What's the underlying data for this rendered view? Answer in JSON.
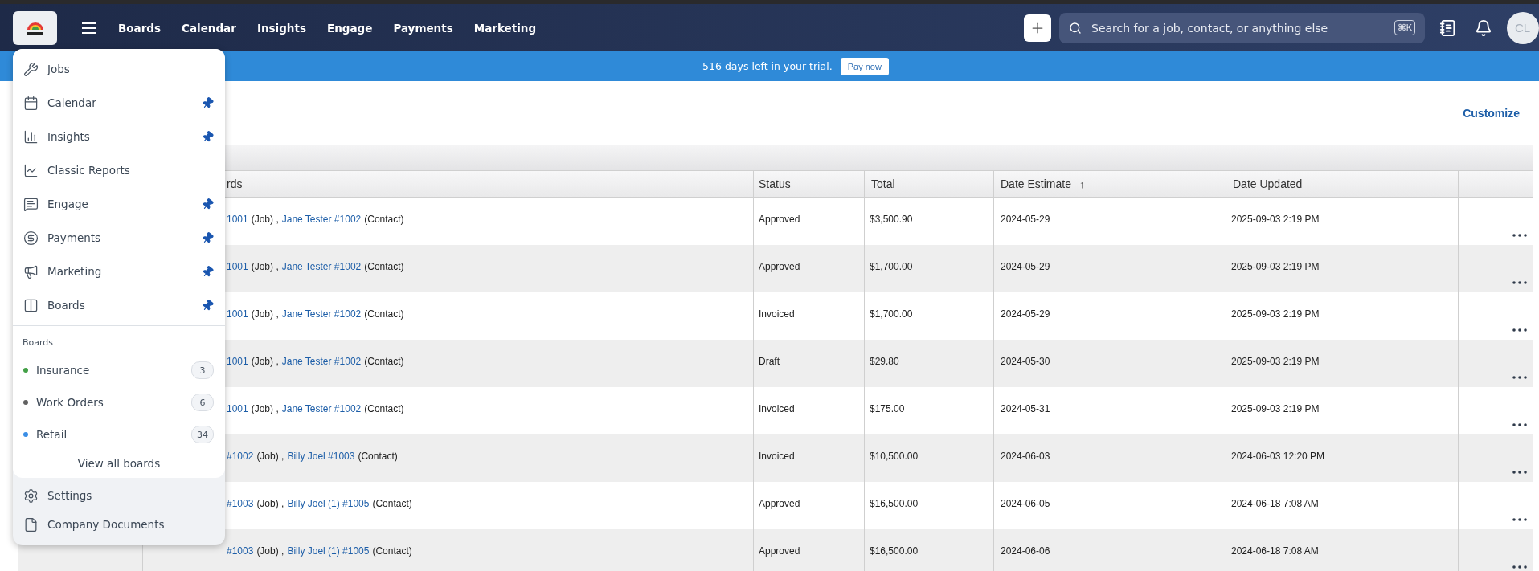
{
  "nav": {
    "links": [
      "Boards",
      "Calendar",
      "Insights",
      "Engage",
      "Payments",
      "Marketing"
    ],
    "search": {
      "placeholder": "Search for a job, contact, or anything else",
      "shortcut": "⌘K"
    },
    "avatar": "CL"
  },
  "banner": {
    "text": "516 days left in your trial.",
    "button": "Pay now"
  },
  "customize": "Customize",
  "table": {
    "columns": [
      {
        "label": "rds"
      },
      {
        "label": "Status"
      },
      {
        "label": "Total"
      },
      {
        "label": "Date Estimate",
        "sort_mark": "↑"
      },
      {
        "label": "Date Updated"
      }
    ],
    "rows": [
      {
        "records": [
          {
            "kind": "link",
            "text": "1001"
          },
          {
            "kind": "plain",
            "text": "(Job) ,"
          },
          {
            "kind": "link",
            "text": "Jane Tester #1002"
          },
          {
            "kind": "plain",
            "text": "(Contact)"
          }
        ],
        "status": "Approved",
        "total": "$3,500.90",
        "date_estimate": "2024-05-29",
        "date_updated": "2025-09-03 2:19 PM"
      },
      {
        "records": [
          {
            "kind": "link",
            "text": "1001"
          },
          {
            "kind": "plain",
            "text": "(Job) ,"
          },
          {
            "kind": "link",
            "text": "Jane Tester #1002"
          },
          {
            "kind": "plain",
            "text": "(Contact)"
          }
        ],
        "status": "Approved",
        "total": "$1,700.00",
        "date_estimate": "2024-05-29",
        "date_updated": "2025-09-03 2:19 PM"
      },
      {
        "records": [
          {
            "kind": "link",
            "text": "1001"
          },
          {
            "kind": "plain",
            "text": "(Job) ,"
          },
          {
            "kind": "link",
            "text": "Jane Tester #1002"
          },
          {
            "kind": "plain",
            "text": "(Contact)"
          }
        ],
        "status": "Invoiced",
        "total": "$1,700.00",
        "date_estimate": "2024-05-29",
        "date_updated": "2025-09-03 2:19 PM"
      },
      {
        "records": [
          {
            "kind": "link",
            "text": "1001"
          },
          {
            "kind": "plain",
            "text": "(Job) ,"
          },
          {
            "kind": "link",
            "text": "Jane Tester #1002"
          },
          {
            "kind": "plain",
            "text": "(Contact)"
          }
        ],
        "status": "Draft",
        "total": "$29.80",
        "date_estimate": "2024-05-30",
        "date_updated": "2025-09-03 2:19 PM"
      },
      {
        "records": [
          {
            "kind": "link",
            "text": "1001"
          },
          {
            "kind": "plain",
            "text": "(Job) ,"
          },
          {
            "kind": "link",
            "text": "Jane Tester #1002"
          },
          {
            "kind": "plain",
            "text": "(Contact)"
          }
        ],
        "status": "Invoiced",
        "total": "$175.00",
        "date_estimate": "2024-05-31",
        "date_updated": "2025-09-03 2:19 PM"
      },
      {
        "records": [
          {
            "kind": "link",
            "text": "#1002"
          },
          {
            "kind": "plain",
            "text": "(Job) ,"
          },
          {
            "kind": "link",
            "text": "Billy Joel #1003"
          },
          {
            "kind": "plain",
            "text": "(Contact)"
          }
        ],
        "status": "Invoiced",
        "total": "$10,500.00",
        "date_estimate": "2024-06-03",
        "date_updated": "2024-06-03 12:20 PM"
      },
      {
        "records": [
          {
            "kind": "link",
            "text": "#1003"
          },
          {
            "kind": "plain",
            "text": "(Job) ,"
          },
          {
            "kind": "link",
            "text": "Billy Joel (1) #1005"
          },
          {
            "kind": "plain",
            "text": "(Contact)"
          }
        ],
        "status": "Approved",
        "total": "$16,500.00",
        "date_estimate": "2024-06-05",
        "date_updated": "2024-06-18 7:08 AM"
      },
      {
        "records": [
          {
            "kind": "link",
            "text": "#1003"
          },
          {
            "kind": "plain",
            "text": "(Job) ,"
          },
          {
            "kind": "link",
            "text": "Billy Joel (1) #1005"
          },
          {
            "kind": "plain",
            "text": "(Contact)"
          }
        ],
        "status": "Approved",
        "total": "$16,500.00",
        "date_estimate": "2024-06-06",
        "date_updated": "2024-06-18 7:08 AM"
      }
    ]
  },
  "menu": {
    "items": [
      {
        "label": "Jobs",
        "pinned": false
      },
      {
        "label": "Calendar",
        "pinned": true
      },
      {
        "label": "Insights",
        "pinned": true
      },
      {
        "label": "Classic Reports",
        "pinned": false
      },
      {
        "label": "Engage",
        "pinned": true
      },
      {
        "label": "Payments",
        "pinned": true
      },
      {
        "label": "Marketing",
        "pinned": true
      },
      {
        "label": "Boards",
        "pinned": true
      }
    ],
    "boards_heading": "Boards",
    "boards": [
      {
        "name": "Insurance",
        "count": "3",
        "color": "#43a047"
      },
      {
        "name": "Work Orders",
        "count": "6",
        "color": "#616161"
      },
      {
        "name": "Retail",
        "count": "34",
        "color": "#3a8ee6"
      }
    ],
    "view_all": "View all boards",
    "footer": [
      {
        "label": "Settings"
      },
      {
        "label": "Company Documents"
      }
    ]
  }
}
